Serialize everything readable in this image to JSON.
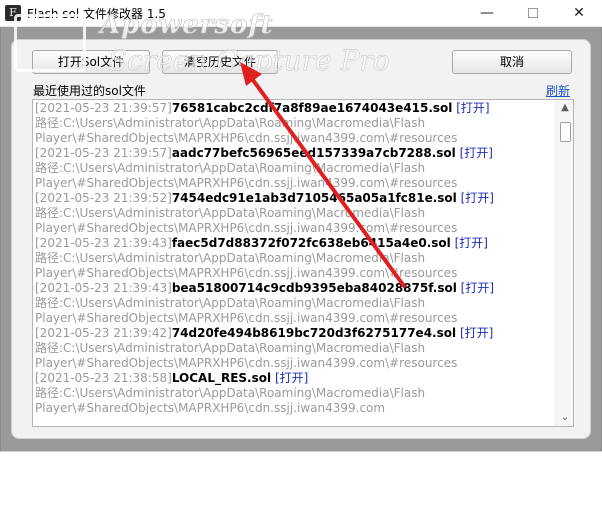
{
  "window": {
    "title": "Flash sol 文件修改器 1.5",
    "icon": "app-icon",
    "icon_glyph": "F",
    "minimize_glyph": "—",
    "close_glyph": "✕"
  },
  "toolbar": {
    "open_sol_label": "打开Sol文件",
    "clear_label": "清空历史文件",
    "cancel_label": "取消"
  },
  "list": {
    "label": "最近使用过的sol文件",
    "refresh_label": "刷新",
    "entries": [
      {
        "timestamp": "[2021-05-23 21:39:57]",
        "filename": "76581cabc2cdf7a8f89ae1674043e415.sol",
        "open_label": "[打开]",
        "path_line1": "路径:C:\\Users\\Administrator\\AppData\\Roaming\\Macromedia\\Flash",
        "path_line2": "Player\\#SharedObjects\\MAPRXHP6\\cdn.ssjj.iwan4399.com\\#resources"
      },
      {
        "timestamp": "[2021-05-23 21:39:57]",
        "filename": "aadc77befc56965eed157339a7cb7288.sol",
        "open_label": "[打开]",
        "path_line1": "路径:C:\\Users\\Administrator\\AppData\\Roaming\\Macromedia\\Flash",
        "path_line2": "Player\\#SharedObjects\\MAPRXHP6\\cdn.ssjj.iwan4399.com\\#resources"
      },
      {
        "timestamp": "[2021-05-23 21:39:52]",
        "filename": "7454edc91e1ab3d7105465a05a1fc81e.sol",
        "open_label": "[打开]",
        "path_line1": "路径:C:\\Users\\Administrator\\AppData\\Roaming\\Macromedia\\Flash",
        "path_line2": "Player\\#SharedObjects\\MAPRXHP6\\cdn.ssjj.iwan4399.com\\#resources"
      },
      {
        "timestamp": "[2021-05-23 21:39:43]",
        "filename": "faec5d7d88372f072fc638eb6415a4e0.sol",
        "open_label": "[打开]",
        "path_line1": "路径:C:\\Users\\Administrator\\AppData\\Roaming\\Macromedia\\Flash",
        "path_line2": "Player\\#SharedObjects\\MAPRXHP6\\cdn.ssjj.iwan4399.com\\#resources"
      },
      {
        "timestamp": "[2021-05-23 21:39:43]",
        "filename": "bea51800714c9cdb9395eba84028875f.sol",
        "open_label": "[打开]",
        "path_line1": "路径:C:\\Users\\Administrator\\AppData\\Roaming\\Macromedia\\Flash",
        "path_line2": "Player\\#SharedObjects\\MAPRXHP6\\cdn.ssjj.iwan4399.com\\#resources"
      },
      {
        "timestamp": "[2021-05-23 21:39:42]",
        "filename": "74d20fe494b8619bc720d3f6275177e4.sol",
        "open_label": "[打开]",
        "path_line1": "路径:C:\\Users\\Administrator\\AppData\\Roaming\\Macromedia\\Flash",
        "path_line2": "Player\\#SharedObjects\\MAPRXHP6\\cdn.ssjj.iwan4399.com\\#resources"
      },
      {
        "timestamp": "[2021-05-23 21:38:58]",
        "filename": "LOCAL_RES.sol",
        "open_label": "[打开]",
        "path_line1": "路径:C:\\Users\\Administrator\\AppData\\Roaming\\Macromedia\\Flash",
        "path_line2": "Player\\#SharedObjects\\MAPRXHP6\\cdn.ssjj.iwan4399.com"
      }
    ]
  },
  "scrollbar": {
    "up_glyph": "▲",
    "down_glyph": "⌄"
  },
  "watermark": {
    "line1": "Apowersoft",
    "line2": "Screen Capture Pro"
  },
  "colors": {
    "link": "#1a52c9",
    "open_link": "#1c2fb8",
    "timestamp": "#9a9a9a",
    "annotation_arrow": "#e02020"
  }
}
